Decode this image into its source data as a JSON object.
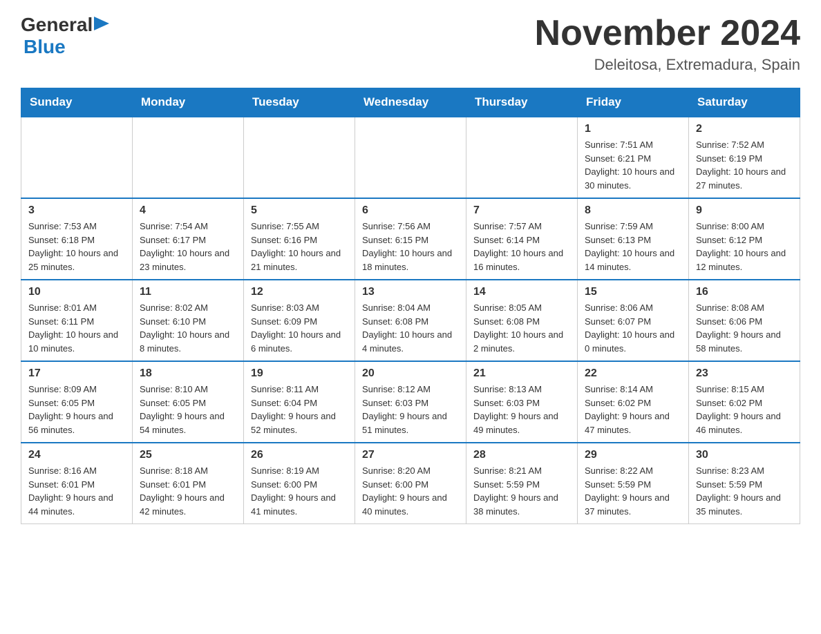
{
  "header": {
    "logo": {
      "general_text": "General",
      "blue_text": "Blue"
    },
    "title": "November 2024",
    "location": "Deleitosa, Extremadura, Spain"
  },
  "days_of_week": [
    "Sunday",
    "Monday",
    "Tuesday",
    "Wednesday",
    "Thursday",
    "Friday",
    "Saturday"
  ],
  "weeks": [
    {
      "cells": [
        {
          "day": null,
          "info": null
        },
        {
          "day": null,
          "info": null
        },
        {
          "day": null,
          "info": null
        },
        {
          "day": null,
          "info": null
        },
        {
          "day": null,
          "info": null
        },
        {
          "day": "1",
          "info": "Sunrise: 7:51 AM\nSunset: 6:21 PM\nDaylight: 10 hours and 30 minutes."
        },
        {
          "day": "2",
          "info": "Sunrise: 7:52 AM\nSunset: 6:19 PM\nDaylight: 10 hours and 27 minutes."
        }
      ]
    },
    {
      "cells": [
        {
          "day": "3",
          "info": "Sunrise: 7:53 AM\nSunset: 6:18 PM\nDaylight: 10 hours and 25 minutes."
        },
        {
          "day": "4",
          "info": "Sunrise: 7:54 AM\nSunset: 6:17 PM\nDaylight: 10 hours and 23 minutes."
        },
        {
          "day": "5",
          "info": "Sunrise: 7:55 AM\nSunset: 6:16 PM\nDaylight: 10 hours and 21 minutes."
        },
        {
          "day": "6",
          "info": "Sunrise: 7:56 AM\nSunset: 6:15 PM\nDaylight: 10 hours and 18 minutes."
        },
        {
          "day": "7",
          "info": "Sunrise: 7:57 AM\nSunset: 6:14 PM\nDaylight: 10 hours and 16 minutes."
        },
        {
          "day": "8",
          "info": "Sunrise: 7:59 AM\nSunset: 6:13 PM\nDaylight: 10 hours and 14 minutes."
        },
        {
          "day": "9",
          "info": "Sunrise: 8:00 AM\nSunset: 6:12 PM\nDaylight: 10 hours and 12 minutes."
        }
      ]
    },
    {
      "cells": [
        {
          "day": "10",
          "info": "Sunrise: 8:01 AM\nSunset: 6:11 PM\nDaylight: 10 hours and 10 minutes."
        },
        {
          "day": "11",
          "info": "Sunrise: 8:02 AM\nSunset: 6:10 PM\nDaylight: 10 hours and 8 minutes."
        },
        {
          "day": "12",
          "info": "Sunrise: 8:03 AM\nSunset: 6:09 PM\nDaylight: 10 hours and 6 minutes."
        },
        {
          "day": "13",
          "info": "Sunrise: 8:04 AM\nSunset: 6:08 PM\nDaylight: 10 hours and 4 minutes."
        },
        {
          "day": "14",
          "info": "Sunrise: 8:05 AM\nSunset: 6:08 PM\nDaylight: 10 hours and 2 minutes."
        },
        {
          "day": "15",
          "info": "Sunrise: 8:06 AM\nSunset: 6:07 PM\nDaylight: 10 hours and 0 minutes."
        },
        {
          "day": "16",
          "info": "Sunrise: 8:08 AM\nSunset: 6:06 PM\nDaylight: 9 hours and 58 minutes."
        }
      ]
    },
    {
      "cells": [
        {
          "day": "17",
          "info": "Sunrise: 8:09 AM\nSunset: 6:05 PM\nDaylight: 9 hours and 56 minutes."
        },
        {
          "day": "18",
          "info": "Sunrise: 8:10 AM\nSunset: 6:05 PM\nDaylight: 9 hours and 54 minutes."
        },
        {
          "day": "19",
          "info": "Sunrise: 8:11 AM\nSunset: 6:04 PM\nDaylight: 9 hours and 52 minutes."
        },
        {
          "day": "20",
          "info": "Sunrise: 8:12 AM\nSunset: 6:03 PM\nDaylight: 9 hours and 51 minutes."
        },
        {
          "day": "21",
          "info": "Sunrise: 8:13 AM\nSunset: 6:03 PM\nDaylight: 9 hours and 49 minutes."
        },
        {
          "day": "22",
          "info": "Sunrise: 8:14 AM\nSunset: 6:02 PM\nDaylight: 9 hours and 47 minutes."
        },
        {
          "day": "23",
          "info": "Sunrise: 8:15 AM\nSunset: 6:02 PM\nDaylight: 9 hours and 46 minutes."
        }
      ]
    },
    {
      "cells": [
        {
          "day": "24",
          "info": "Sunrise: 8:16 AM\nSunset: 6:01 PM\nDaylight: 9 hours and 44 minutes."
        },
        {
          "day": "25",
          "info": "Sunrise: 8:18 AM\nSunset: 6:01 PM\nDaylight: 9 hours and 42 minutes."
        },
        {
          "day": "26",
          "info": "Sunrise: 8:19 AM\nSunset: 6:00 PM\nDaylight: 9 hours and 41 minutes."
        },
        {
          "day": "27",
          "info": "Sunrise: 8:20 AM\nSunset: 6:00 PM\nDaylight: 9 hours and 40 minutes."
        },
        {
          "day": "28",
          "info": "Sunrise: 8:21 AM\nSunset: 5:59 PM\nDaylight: 9 hours and 38 minutes."
        },
        {
          "day": "29",
          "info": "Sunrise: 8:22 AM\nSunset: 5:59 PM\nDaylight: 9 hours and 37 minutes."
        },
        {
          "day": "30",
          "info": "Sunrise: 8:23 AM\nSunset: 5:59 PM\nDaylight: 9 hours and 35 minutes."
        }
      ]
    }
  ]
}
